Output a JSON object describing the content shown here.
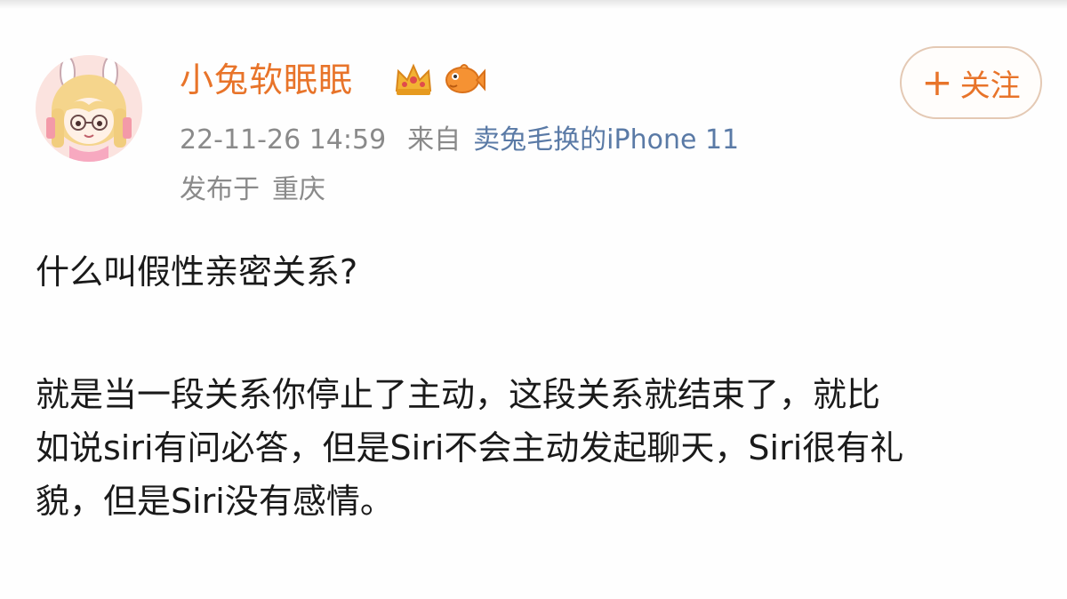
{
  "user": {
    "name": "小兔软眠眠",
    "badges": [
      "crown-icon",
      "fish-icon"
    ],
    "brand_color": "#e8742a"
  },
  "meta": {
    "timestamp": "22-11-26 14:59",
    "source_prefix": "来自",
    "source": "卖兔毛换的iPhone 11",
    "location_prefix": "发布于",
    "location": "重庆"
  },
  "follow": {
    "icon": "plus-icon",
    "plus_glyph": "+",
    "label": "关注"
  },
  "post": {
    "title": "什么叫假性亲密关系?",
    "body_lines": [
      "就是当一段关系你停止了主动，这段关系就结束了，就比",
      "如说siri有问必答，但是Siri不会主动发起聊天，Siri很有礼",
      "貌，但是Siri没有感情。"
    ]
  }
}
